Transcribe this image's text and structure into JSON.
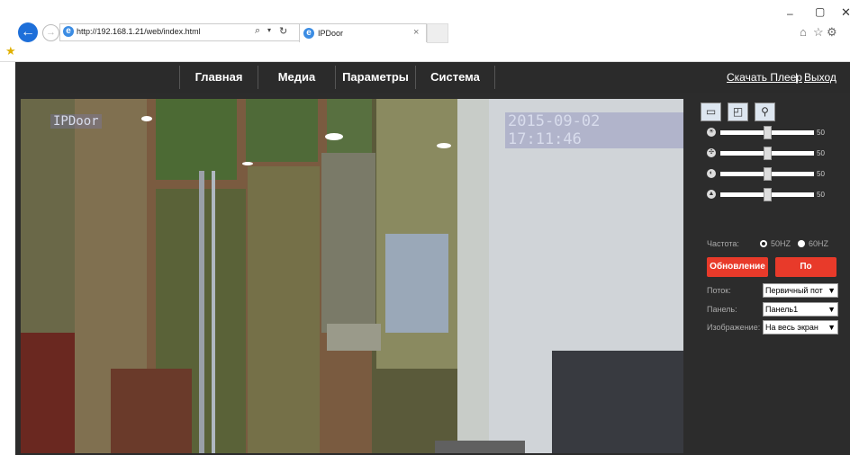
{
  "browser": {
    "url": "http://192.168.1.21/web/index.html",
    "tab_title": "IPDoor",
    "search_glyph": "⌕",
    "dropdown_glyph": "▾",
    "refresh_glyph": "↻",
    "close_glyph": "×",
    "min_glyph": "–",
    "max_glyph": "▢",
    "win_close_glyph": "✕",
    "home_glyph": "⌂",
    "star_glyph": "☆",
    "gear_glyph": "⚙",
    "fav_glyph": "★"
  },
  "nav": {
    "items": [
      "Главная",
      "Медиа",
      "Параметры",
      "Система"
    ],
    "download_player": "Скачать Плеер",
    "separator": "|",
    "logout": "Выход"
  },
  "video": {
    "osd_name": "IPDoor",
    "osd_time": "2015-09-02 17:11:46"
  },
  "panel": {
    "tools": [
      "camera-icon",
      "snapshot-icon",
      "settings-icon"
    ],
    "sliders": [
      {
        "icon": "brightness-icon",
        "value": 50
      },
      {
        "icon": "contrast-icon",
        "value": 50
      },
      {
        "icon": "saturation-icon",
        "value": 50
      },
      {
        "icon": "sharpness-icon",
        "value": 50
      }
    ],
    "frequency_label": "Частота:",
    "freq_50": "50HZ",
    "freq_60": "60HZ",
    "freq_selected": "50HZ",
    "refresh_btn": "Обновление",
    "default_btn": "По умолчанию",
    "stream_label": "Поток:",
    "stream_value": "Первичный пот",
    "panel_label": "Панель:",
    "panel_value": "Панель1",
    "image_label": "Изображение:",
    "image_value": "На весь экран"
  },
  "colors": {
    "accent_red": "#e83a2a",
    "nav_bg": "#2b2b2b",
    "panel_bg": "#2c2c2c"
  }
}
